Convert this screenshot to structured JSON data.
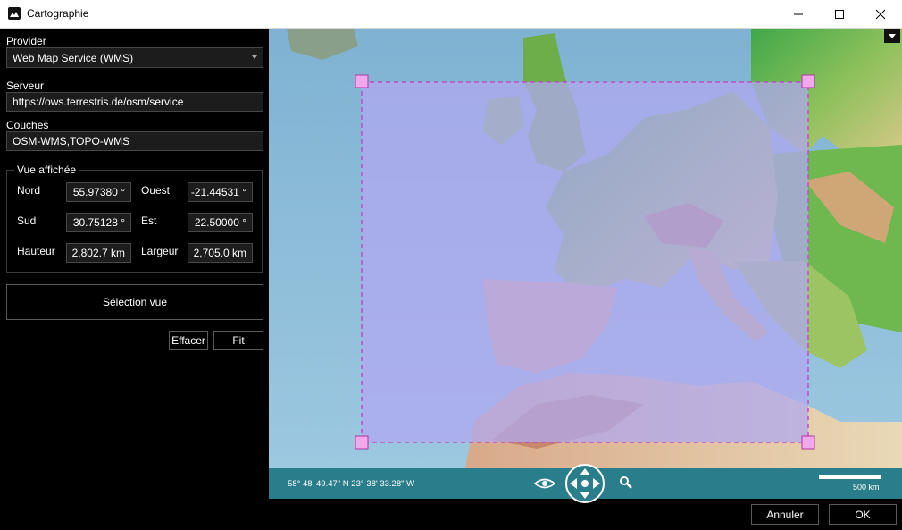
{
  "window": {
    "title": "Cartographie"
  },
  "provider": {
    "label": "Provider",
    "value": "Web Map Service (WMS)"
  },
  "server": {
    "label": "Serveur",
    "value": "https://ows.terrestris.de/osm/service"
  },
  "layers": {
    "label": "Couches",
    "value": "OSM-WMS,TOPO-WMS"
  },
  "view": {
    "legend": "Vue affichée",
    "north_label": "Nord",
    "north_value": "55.97380 °",
    "west_label": "Ouest",
    "west_value": "-21.44531 °",
    "south_label": "Sud",
    "south_value": "30.75128 °",
    "east_label": "Est",
    "east_value": "22.50000 °",
    "height_label": "Hauteur",
    "height_value": "2,802.7 km",
    "width_label": "Largeur",
    "width_value": "2,705.0 km"
  },
  "actions": {
    "select_view": "Sélection vue",
    "clear": "Effacer",
    "fit": "Fit"
  },
  "map": {
    "cursor_coords": "58° 48' 49.47\" N 23° 38' 33.28\" W",
    "scale_label": "500 km",
    "colors": {
      "sea": "#8fbcd8",
      "selection": "#c04cc8",
      "statusbar": "#2a7d8a"
    }
  },
  "footer": {
    "cancel": "Annuler",
    "ok": "OK"
  },
  "icons": [
    "app-icon",
    "minimize-icon",
    "maximize-icon",
    "close-icon",
    "dropdown-icon",
    "eye-icon",
    "pan-control-icon",
    "zoom-search-icon"
  ]
}
